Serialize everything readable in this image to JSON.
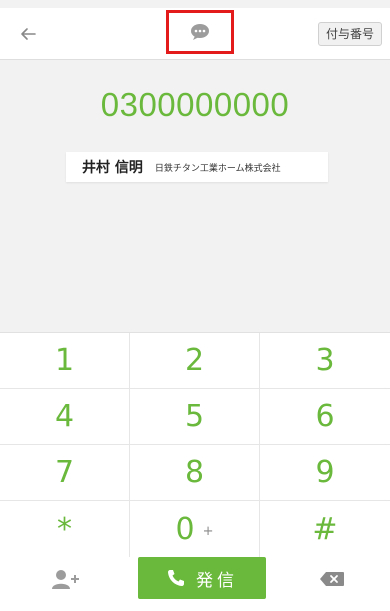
{
  "header": {
    "back_icon": "arrow-left-icon",
    "message_icon": "speech-bubble-icon",
    "extension_label": "付与番号"
  },
  "display": {
    "number": "0300000000",
    "contact": {
      "name": "井村 信明",
      "company": "日鉄チタン工業ホーム株式会社"
    }
  },
  "keypad": {
    "keys": [
      {
        "digit": "1"
      },
      {
        "digit": "2"
      },
      {
        "digit": "3"
      },
      {
        "digit": "4"
      },
      {
        "digit": "5"
      },
      {
        "digit": "6"
      },
      {
        "digit": "7"
      },
      {
        "digit": "8"
      },
      {
        "digit": "9"
      },
      {
        "digit": "*"
      },
      {
        "digit": "0",
        "sub": "+"
      },
      {
        "digit": "#"
      }
    ]
  },
  "footer": {
    "add_contact_icon": "add-person-icon",
    "call_label": "発信",
    "call_icon": "phone-icon",
    "backspace_icon": "backspace-icon"
  },
  "colors": {
    "accent": "#6ab83c",
    "highlight_border": "#e41b1b"
  }
}
